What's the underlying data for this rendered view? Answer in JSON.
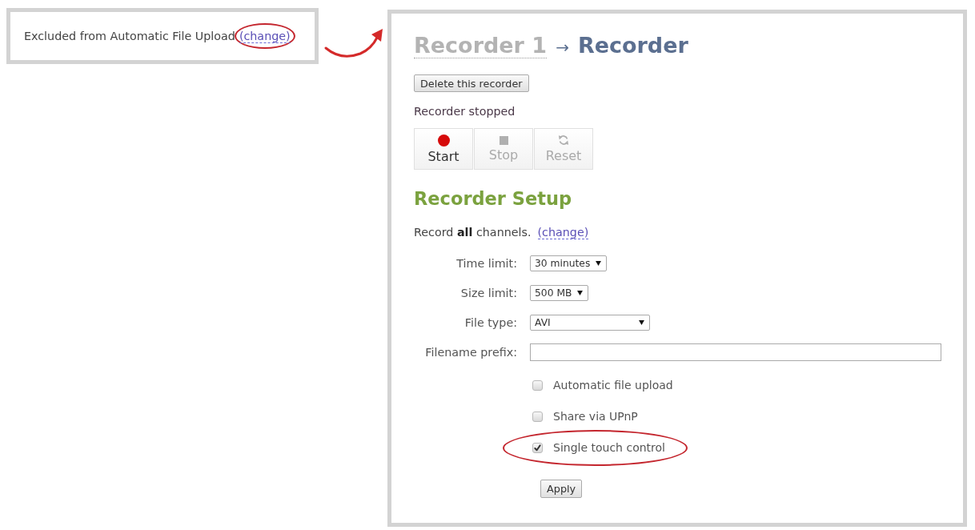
{
  "callout": {
    "text": "Excluded from Automatic File Upload",
    "link": {
      "label": "(change)",
      "highlighted": true
    }
  },
  "recorder": {
    "breadcrumb": {
      "parent": "Recorder 1",
      "separator": "→",
      "current": "Recorder"
    },
    "delete_button": "Delete this recorder",
    "status": "Recorder stopped",
    "controls": [
      {
        "kind": "start",
        "label": "Start",
        "disabled": false
      },
      {
        "kind": "stop",
        "label": "Stop",
        "disabled": true
      },
      {
        "kind": "reset",
        "label": "Reset",
        "disabled": true
      }
    ],
    "setup_title": "Recorder Setup",
    "channels": {
      "text": "Record **all** channels.",
      "link": {
        "label": "(change)"
      }
    },
    "fields": [
      {
        "kind": "select",
        "label": "Time limit:",
        "value": "30 minutes"
      },
      {
        "kind": "select",
        "label": "Size limit:",
        "value": "500 MB"
      },
      {
        "kind": "select",
        "label": "File type:",
        "value": "AVI"
      },
      {
        "kind": "text",
        "label": "Filename prefix:"
      }
    ],
    "options": [
      {
        "label": "Automatic file upload",
        "checked": false,
        "highlighted": false
      },
      {
        "label": "Share via UPnP",
        "checked": false,
        "highlighted": false
      },
      {
        "label": "Single touch control",
        "checked": true,
        "highlighted": true
      }
    ],
    "apply_button": "Apply"
  }
}
